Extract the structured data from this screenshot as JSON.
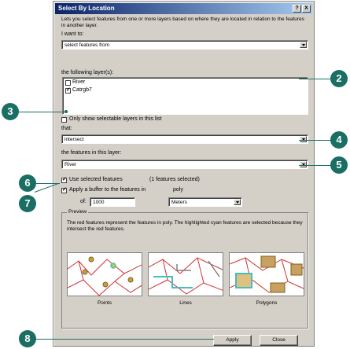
{
  "window": {
    "title": "Select By Location",
    "help_btn": "?",
    "close_btn": "X"
  },
  "description": "Lets you select features from one or more layers based on where they are located in relation to the features in another layer.",
  "want_label": "I want to:",
  "want_value": "select features from",
  "layers_label": "the following layer(s):",
  "layers": [
    {
      "name": "River",
      "checked": false
    },
    {
      "name": "Catrgb7",
      "checked": true
    }
  ],
  "only_selectable_label": "Only show selectable layers in this list",
  "that_label": "that:",
  "that_value": "intersect",
  "features_label": "the features in this layer:",
  "features_value": "River",
  "use_selected_label": "Use selected features",
  "selected_count": "(1 features selected)",
  "buffer_label": "Apply a buffer to the features in",
  "buffer_layer": "poly",
  "of_label": "of:",
  "buffer_value": "1000",
  "units_value": "Meters",
  "preview": {
    "title": "Preview",
    "text": "The red features represent the features in poly. The highlighted cyan features are selected because they intersect the red features.",
    "panels": [
      "Points",
      "Lines",
      "Polygons"
    ]
  },
  "buttons": {
    "apply": "Apply",
    "close": "Close"
  },
  "callouts": [
    "2",
    "3",
    "4",
    "5",
    "6",
    "7",
    "8"
  ],
  "colors": {
    "callout": "#1a6e63",
    "title_bar": "#0a246a",
    "dialog": "#d4d0c8"
  }
}
